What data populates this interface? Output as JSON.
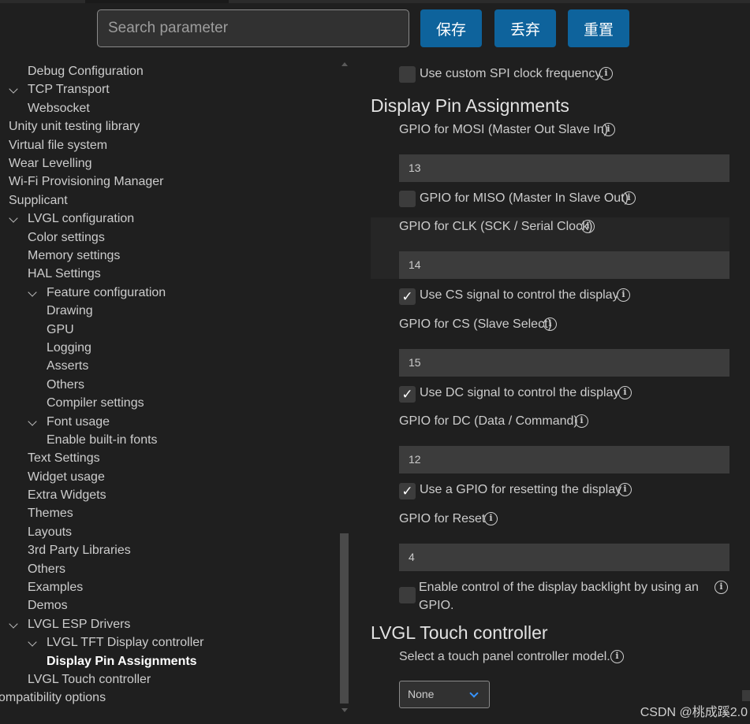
{
  "toolbar": {
    "search_placeholder": "Search parameter",
    "save_label": "保存",
    "discard_label": "丢弃",
    "reset_label": "重置",
    "accent_color": "#0e639c"
  },
  "tree": {
    "items": [
      {
        "label": "Debug Configuration"
      },
      {
        "label": "TCP Transport"
      },
      {
        "label": "Websocket"
      },
      {
        "label": "Unity unit testing library"
      },
      {
        "label": "Virtual file system"
      },
      {
        "label": "Wear Levelling"
      },
      {
        "label": "Wi-Fi Provisioning Manager"
      },
      {
        "label": "Supplicant"
      },
      {
        "label": "LVGL configuration"
      },
      {
        "label": "Color settings"
      },
      {
        "label": "Memory settings"
      },
      {
        "label": "HAL Settings"
      },
      {
        "label": "Feature configuration"
      },
      {
        "label": "Drawing"
      },
      {
        "label": "GPU"
      },
      {
        "label": "Logging"
      },
      {
        "label": "Asserts"
      },
      {
        "label": "Others"
      },
      {
        "label": "Compiler settings"
      },
      {
        "label": "Font usage"
      },
      {
        "label": "Enable built-in fonts"
      },
      {
        "label": "Text Settings"
      },
      {
        "label": "Widget usage"
      },
      {
        "label": "Extra Widgets"
      },
      {
        "label": "Themes"
      },
      {
        "label": "Layouts"
      },
      {
        "label": "3rd Party Libraries"
      },
      {
        "label": "Others"
      },
      {
        "label": "Examples"
      },
      {
        "label": "Demos"
      },
      {
        "label": "LVGL ESP Drivers"
      },
      {
        "label": "LVGL TFT Display controller"
      },
      {
        "label": "Display Pin Assignments"
      },
      {
        "label": "LVGL Touch controller"
      },
      {
        "label": "ompatibility options"
      }
    ]
  },
  "settings": {
    "custom_spi_clock": {
      "label": "Use custom SPI clock frequency.",
      "checked": false
    },
    "display_pin_title": "Display Pin Assignments",
    "mosi": {
      "label": "GPIO for MOSI (Master Out Slave In)",
      "value": "13"
    },
    "miso": {
      "label": "GPIO for MISO (Master In Slave Out)",
      "checked": false
    },
    "clk": {
      "label": "GPIO for CLK (SCK / Serial Clock)",
      "value": "14"
    },
    "use_cs": {
      "label": "Use CS signal to control the display",
      "checked": true
    },
    "cs": {
      "label": "GPIO for CS (Slave Select)",
      "value": "15"
    },
    "use_dc": {
      "label": "Use DC signal to control the display",
      "checked": true
    },
    "dc": {
      "label": "GPIO for DC (Data / Command)",
      "value": "12"
    },
    "use_reset": {
      "label": "Use a GPIO for resetting the display",
      "checked": true
    },
    "reset": {
      "label": "GPIO for Reset",
      "value": "4"
    },
    "backlight": {
      "label_line1": "Enable control of the display backlight by using an",
      "label_line2": "GPIO.",
      "checked": false
    },
    "touch_title": "LVGL Touch controller",
    "touch_model": {
      "label": "Select a touch panel controller model.",
      "value": "None"
    },
    "check_glyph": "✓",
    "info_glyph": "i"
  },
  "watermark": "CSDN @桃成蹊2.0"
}
